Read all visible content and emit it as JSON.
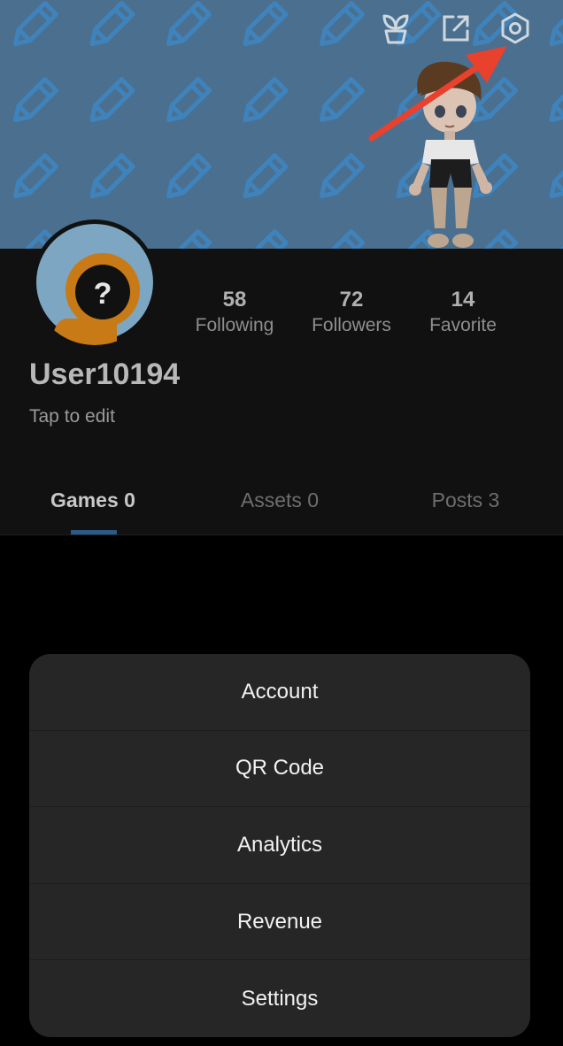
{
  "header": {
    "icons": [
      "sprout-icon",
      "share-icon",
      "settings-gear-icon"
    ]
  },
  "profile": {
    "username": "User10194",
    "edit_hint": "Tap to edit",
    "stats": [
      {
        "value": "58",
        "label": "Following"
      },
      {
        "value": "72",
        "label": "Followers"
      },
      {
        "value": "14",
        "label": "Favorite"
      }
    ]
  },
  "tabs": [
    {
      "label": "Games 0",
      "active": true
    },
    {
      "label": "Assets 0",
      "active": false
    },
    {
      "label": "Posts 3",
      "active": false
    }
  ],
  "menu": {
    "items": [
      "Account",
      "QR Code",
      "Analytics",
      "Revenue",
      "Settings"
    ]
  },
  "colors": {
    "banner": "#4a6f8f",
    "accent": "#2c5a86",
    "arrow": "#e8412e"
  }
}
